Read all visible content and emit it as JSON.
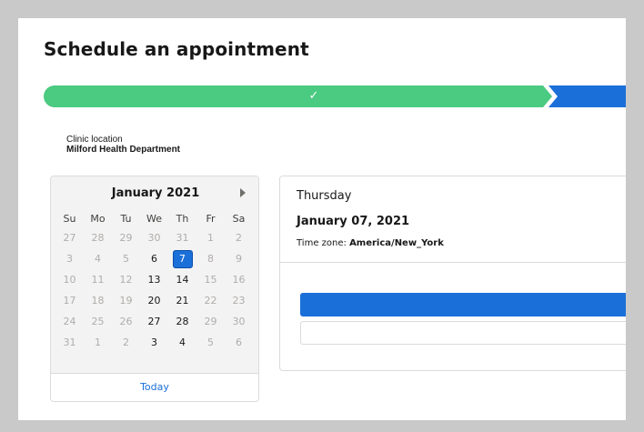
{
  "page": {
    "title": "Schedule an appointment"
  },
  "progress": {
    "steps": [
      {
        "status": "complete",
        "icon": "check-icon",
        "color": "#4bca81"
      },
      {
        "status": "current",
        "color": "#1b6fd9"
      }
    ],
    "check_glyph": "✓"
  },
  "location": {
    "label": "Clinic location",
    "value": "Milford Health Department"
  },
  "calendar": {
    "month": "January 2021",
    "next_icon": "chevron-right-icon",
    "weekdays": [
      "Su",
      "Mo",
      "Tu",
      "We",
      "Th",
      "Fr",
      "Sa"
    ],
    "weeks": [
      [
        {
          "d": "27",
          "s": "off"
        },
        {
          "d": "28",
          "s": "off"
        },
        {
          "d": "29",
          "s": "off"
        },
        {
          "d": "30",
          "s": "off"
        },
        {
          "d": "31",
          "s": "off"
        },
        {
          "d": "1",
          "s": "off"
        },
        {
          "d": "2",
          "s": "off"
        }
      ],
      [
        {
          "d": "3",
          "s": "off"
        },
        {
          "d": "4",
          "s": "off"
        },
        {
          "d": "5",
          "s": "off"
        },
        {
          "d": "6",
          "s": "cur"
        },
        {
          "d": "7",
          "s": "sel"
        },
        {
          "d": "8",
          "s": "off"
        },
        {
          "d": "9",
          "s": "off"
        }
      ],
      [
        {
          "d": "10",
          "s": "off"
        },
        {
          "d": "11",
          "s": "off"
        },
        {
          "d": "12",
          "s": "off"
        },
        {
          "d": "13",
          "s": "cur"
        },
        {
          "d": "14",
          "s": "cur"
        },
        {
          "d": "15",
          "s": "off"
        },
        {
          "d": "16",
          "s": "off"
        }
      ],
      [
        {
          "d": "17",
          "s": "off"
        },
        {
          "d": "18",
          "s": "off"
        },
        {
          "d": "19",
          "s": "off"
        },
        {
          "d": "20",
          "s": "cur"
        },
        {
          "d": "21",
          "s": "cur"
        },
        {
          "d": "22",
          "s": "off"
        },
        {
          "d": "23",
          "s": "off"
        }
      ],
      [
        {
          "d": "24",
          "s": "off"
        },
        {
          "d": "25",
          "s": "off"
        },
        {
          "d": "26",
          "s": "off"
        },
        {
          "d": "27",
          "s": "cur"
        },
        {
          "d": "28",
          "s": "cur"
        },
        {
          "d": "29",
          "s": "off"
        },
        {
          "d": "30",
          "s": "off"
        }
      ],
      [
        {
          "d": "31",
          "s": "off"
        },
        {
          "d": "1",
          "s": "off"
        },
        {
          "d": "2",
          "s": "off"
        },
        {
          "d": "3",
          "s": "cur"
        },
        {
          "d": "4",
          "s": "cur"
        },
        {
          "d": "5",
          "s": "off"
        },
        {
          "d": "6",
          "s": "off"
        }
      ]
    ],
    "today_label": "Today",
    "selected_color": "#1b6fd9"
  },
  "details": {
    "weekday": "Thursday",
    "date": "January 07, 2021",
    "timezone_label": "Time zone: ",
    "timezone_value": "America/New_York"
  }
}
